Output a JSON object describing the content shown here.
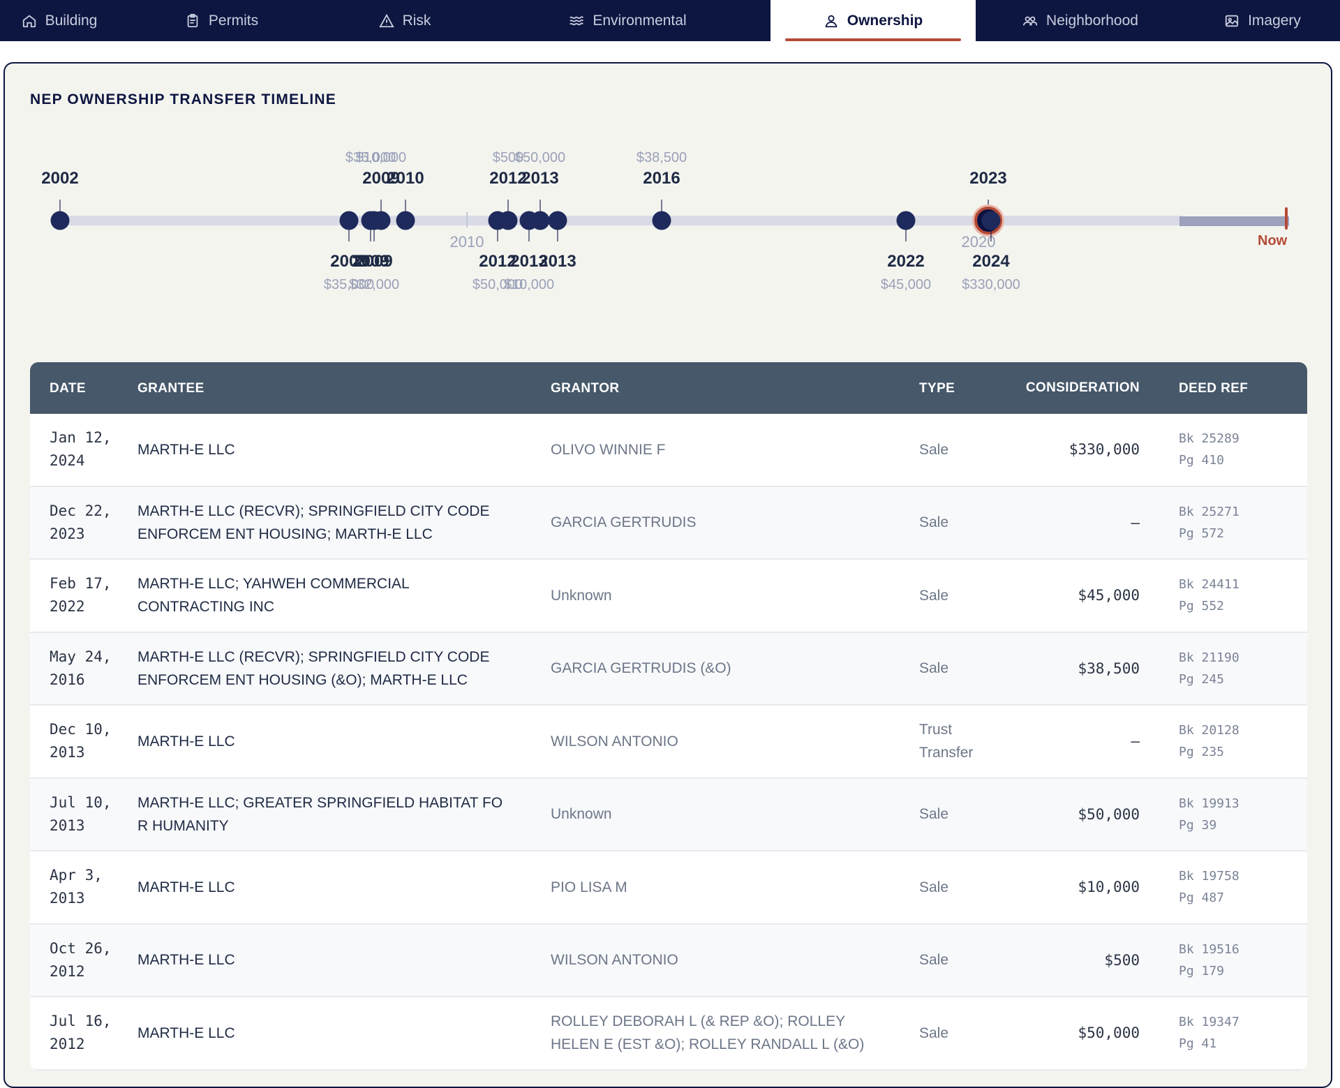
{
  "tabs": [
    {
      "label": "Building",
      "icon": "home-icon",
      "active": false
    },
    {
      "label": "Permits",
      "icon": "clipboard-icon",
      "active": false
    },
    {
      "label": "Risk",
      "icon": "warning-icon",
      "active": false
    },
    {
      "label": "Environmental",
      "icon": "waves-icon",
      "active": false
    },
    {
      "label": "Ownership",
      "icon": "user-icon",
      "active": true
    },
    {
      "label": "Neighborhood",
      "icon": "people-icon",
      "active": false
    },
    {
      "label": "Imagery",
      "icon": "image-icon",
      "active": false
    }
  ],
  "panel": {
    "title": "NEP OWNERSHIP TRANSFER TIMELINE"
  },
  "timeline": {
    "now_label": "Now",
    "decades": [
      "2010",
      "2020"
    ],
    "events": [
      {
        "year": "2002",
        "amount": ""
      },
      {
        "year": "2008",
        "amount": "$35,000"
      },
      {
        "year": "2009",
        "amount": "$35,000"
      },
      {
        "year": "2009",
        "amount": "$32,000"
      },
      {
        "year": "2009",
        "amount": "$10,000"
      },
      {
        "year": "2010",
        "amount": ""
      },
      {
        "year": "2012",
        "amount": "$50,000"
      },
      {
        "year": "2012",
        "amount": "$500"
      },
      {
        "year": "2013",
        "amount": "$10,000"
      },
      {
        "year": "2013",
        "amount": "$50,000"
      },
      {
        "year": "2013",
        "amount": ""
      },
      {
        "year": "2016",
        "amount": "$38,500"
      },
      {
        "year": "2022",
        "amount": "$45,000"
      },
      {
        "year": "2023",
        "amount": ""
      },
      {
        "year": "2024",
        "amount": "$330,000"
      }
    ]
  },
  "table": {
    "headers": {
      "date": "DATE",
      "grantee": "GRANTEE",
      "grantor": "GRANTOR",
      "type": "TYPE",
      "consideration": "CONSIDERATION",
      "deed": "DEED REF"
    },
    "rows": [
      {
        "date1": "Jan 12,",
        "date2": "2024",
        "grantee1": "MARTH-E LLC",
        "grantee2": "",
        "grantor1": "OLIVO WINNIE F",
        "grantor2": "",
        "type1": "Sale",
        "type2": "",
        "consideration": "$330,000",
        "bk": "Bk 25289",
        "pg": "Pg 410"
      },
      {
        "date1": "Dec 22,",
        "date2": "2023",
        "grantee1": "MARTH-E LLC (RECVR); SPRINGFIELD CITY CODE",
        "grantee2": "ENFORCEM ENT HOUSING; MARTH-E LLC",
        "grantor1": "GARCIA GERTRUDIS",
        "grantor2": "",
        "type1": "Sale",
        "type2": "",
        "consideration": "—",
        "bk": "Bk 25271",
        "pg": "Pg 572"
      },
      {
        "date1": "Feb 17,",
        "date2": "2022",
        "grantee1": "MARTH-E LLC; YAHWEH COMMERCIAL",
        "grantee2": "CONTRACTING INC",
        "grantor1": "Unknown",
        "grantor2": "",
        "type1": "Sale",
        "type2": "",
        "consideration": "$45,000",
        "bk": "Bk 24411",
        "pg": "Pg 552"
      },
      {
        "date1": "May 24,",
        "date2": "2016",
        "grantee1": "MARTH-E LLC (RECVR); SPRINGFIELD CITY CODE",
        "grantee2": "ENFORCEM ENT HOUSING (&O); MARTH-E LLC",
        "grantor1": "GARCIA GERTRUDIS (&O)",
        "grantor2": "",
        "type1": "Sale",
        "type2": "",
        "consideration": "$38,500",
        "bk": "Bk 21190",
        "pg": "Pg 245"
      },
      {
        "date1": "Dec 10,",
        "date2": "2013",
        "grantee1": "MARTH-E LLC",
        "grantee2": "",
        "grantor1": "WILSON ANTONIO",
        "grantor2": "",
        "type1": "Trust",
        "type2": "Transfer",
        "consideration": "—",
        "bk": "Bk 20128",
        "pg": "Pg 235"
      },
      {
        "date1": "Jul 10,",
        "date2": "2013",
        "grantee1": "MARTH-E LLC; GREATER SPRINGFIELD HABITAT FO",
        "grantee2": "R HUMANITY",
        "grantor1": "Unknown",
        "grantor2": "",
        "type1": "Sale",
        "type2": "",
        "consideration": "$50,000",
        "bk": "Bk 19913",
        "pg": "Pg 39"
      },
      {
        "date1": "Apr 3,",
        "date2": "2013",
        "grantee1": "MARTH-E LLC",
        "grantee2": "",
        "grantor1": "PIO LISA M",
        "grantor2": "",
        "type1": "Sale",
        "type2": "",
        "consideration": "$10,000",
        "bk": "Bk 19758",
        "pg": "Pg 487"
      },
      {
        "date1": "Oct 26,",
        "date2": "2012",
        "grantee1": "MARTH-E LLC",
        "grantee2": "",
        "grantor1": "WILSON ANTONIO",
        "grantor2": "",
        "type1": "Sale",
        "type2": "",
        "consideration": "$500",
        "bk": "Bk 19516",
        "pg": "Pg 179"
      },
      {
        "date1": "Jul 16,",
        "date2": "2012",
        "grantee1": "MARTH-E LLC",
        "grantee2": "",
        "grantor1": "ROLLEY DEBORAH L (& REP &O); ROLLEY",
        "grantor2": "HELEN E (EST &O); ROLLEY RANDALL L (&O)",
        "type1": "Sale",
        "type2": "",
        "consideration": "$50,000",
        "bk": "Bk 19347",
        "pg": "Pg 41"
      }
    ]
  }
}
